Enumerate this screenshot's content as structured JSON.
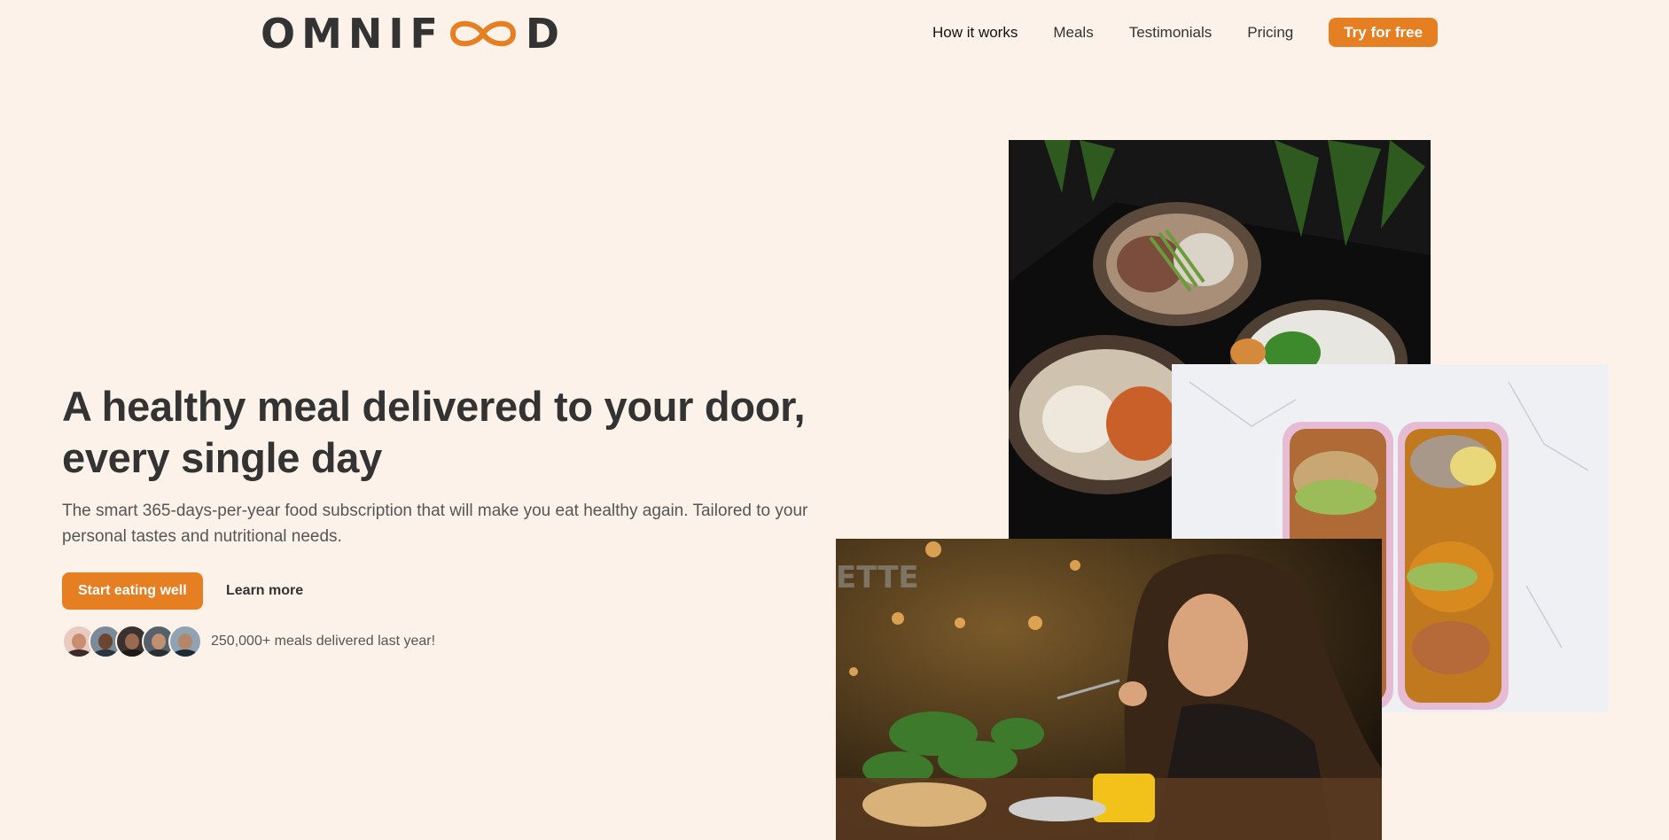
{
  "brand": {
    "logo_text_left": "OMNIF",
    "logo_text_right": "D",
    "accent_color": "#e67e22",
    "background": "#fdf2e9"
  },
  "nav": {
    "items": [
      "How it works",
      "Meals",
      "Testimonials",
      "Pricing"
    ],
    "cta_label": "Try for free"
  },
  "hero": {
    "title_line1": "A healthy meal delivered to your door,",
    "title_line2": "every single day",
    "description_line1": "The smart 365-days-per-year food subscription that will make you eat healthy again. Tailored to your",
    "description_line2": "personal tastes and nutritional needs.",
    "primary_button": "Start eating well",
    "secondary_button": "Learn more",
    "customers_text": "250,000+ meals delivered last year!"
  },
  "icons": {
    "logo": "infinity-icon"
  }
}
